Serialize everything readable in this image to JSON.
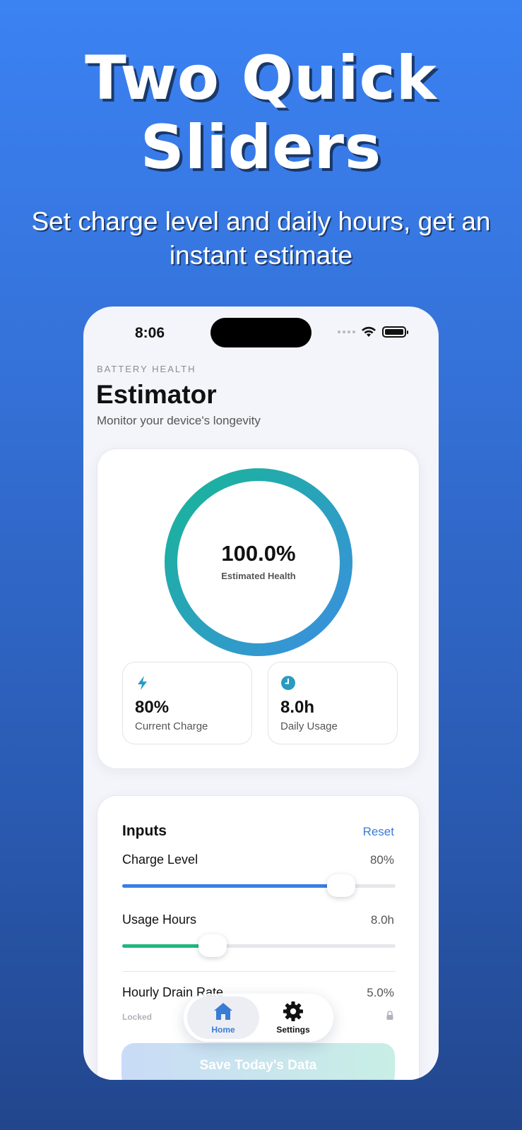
{
  "promo": {
    "headline_line1": "Two Quick",
    "headline_line2": "Sliders",
    "subhead": "Set charge level and daily hours, get an instant estimate"
  },
  "status_bar": {
    "time": "8:06"
  },
  "header": {
    "eyebrow": "BATTERY HEALTH",
    "title": "Estimator",
    "subtitle": "Monitor your device's longevity"
  },
  "health": {
    "value": "100.0%",
    "label": "Estimated Health",
    "level": 1.0,
    "colors": {
      "start": "#18b598",
      "end": "#3b8fe0"
    }
  },
  "stats": [
    {
      "icon": "bolt-icon",
      "value": "80%",
      "label": "Current Charge"
    },
    {
      "icon": "clock-icon",
      "value": "8.0h",
      "label": "Daily Usage"
    }
  ],
  "inputs": {
    "title": "Inputs",
    "reset_label": "Reset",
    "charge": {
      "label": "Charge Level",
      "value": "80%",
      "fraction": 0.8,
      "color": "#3b7de6"
    },
    "usage": {
      "label": "Usage Hours",
      "value": "8.0h",
      "fraction": 0.33,
      "color": "#1fb87e"
    },
    "drain": {
      "label": "Hourly Drain Rate",
      "value": "5.0%",
      "status": "Locked"
    }
  },
  "save_button": {
    "label": "Save Today's Data"
  },
  "tabbar": {
    "home": {
      "label": "Home",
      "icon": "house-icon"
    },
    "settings": {
      "label": "Settings",
      "icon": "gear-icon"
    }
  }
}
